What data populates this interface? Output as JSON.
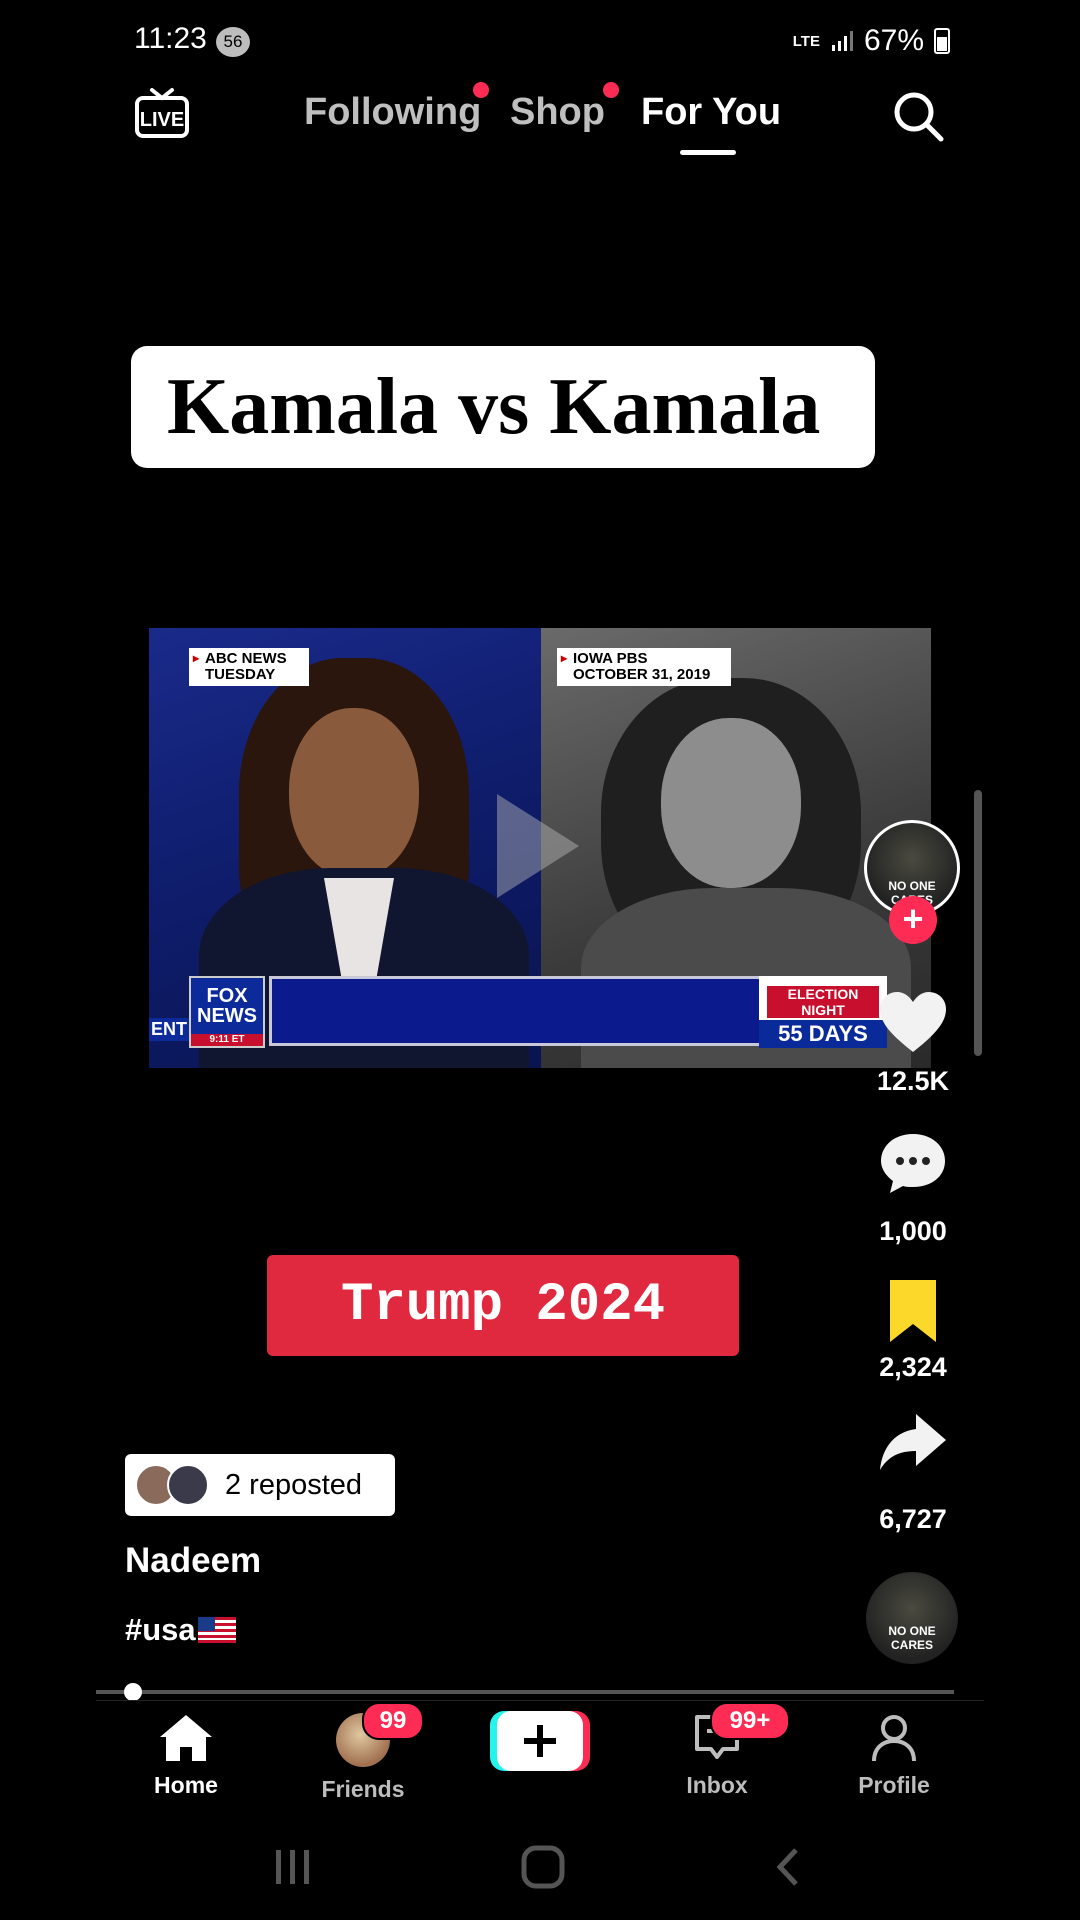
{
  "status_bar": {
    "time": "11:23",
    "notification_count": "56",
    "network": "LTE",
    "battery": "67%"
  },
  "top_nav": {
    "live_icon": "live-tv-icon",
    "tabs": [
      {
        "label": "Following",
        "has_dot": true
      },
      {
        "label": "Shop",
        "has_dot": true
      },
      {
        "label": "For You",
        "active": true
      }
    ],
    "search_icon": "search-icon"
  },
  "video": {
    "title_overlay": "Kamala vs Kamala",
    "left_clip_tag": [
      "ABC NEWS",
      "TUESDAY"
    ],
    "right_clip_tag": [
      "IOWA PBS",
      "OCTOBER 31, 2019"
    ],
    "network_logo": [
      "FOX",
      "NEWS"
    ],
    "network_time": "9:11 ET",
    "ticker_left": "ENT",
    "election_label": [
      "ELECTION",
      "NIGHT"
    ],
    "election_countdown": "55 DAYS",
    "banner": "Trump 2024"
  },
  "author_avatar": {
    "text": "NO ONE CARES"
  },
  "actions": {
    "likes": "12.5K",
    "comments": "1,000",
    "saves": "2,324",
    "shares": "6,727"
  },
  "caption": {
    "repost_text": "2 reposted",
    "author": "Nadeem",
    "hashtag": "#usa"
  },
  "bottom_nav": {
    "items": [
      {
        "label": "Home",
        "icon": "home-icon",
        "active": true
      },
      {
        "label": "Friends",
        "badge": "99"
      },
      {
        "label": "create",
        "icon": "plus-icon"
      },
      {
        "label": "Inbox",
        "icon": "inbox-icon",
        "badge": "99+"
      },
      {
        "label": "Profile",
        "icon": "profile-icon"
      }
    ]
  },
  "colors": {
    "accent": "#fe2c55",
    "banner_red": "#e0293f",
    "save_yellow": "#fcd82b",
    "background": "#000000"
  }
}
